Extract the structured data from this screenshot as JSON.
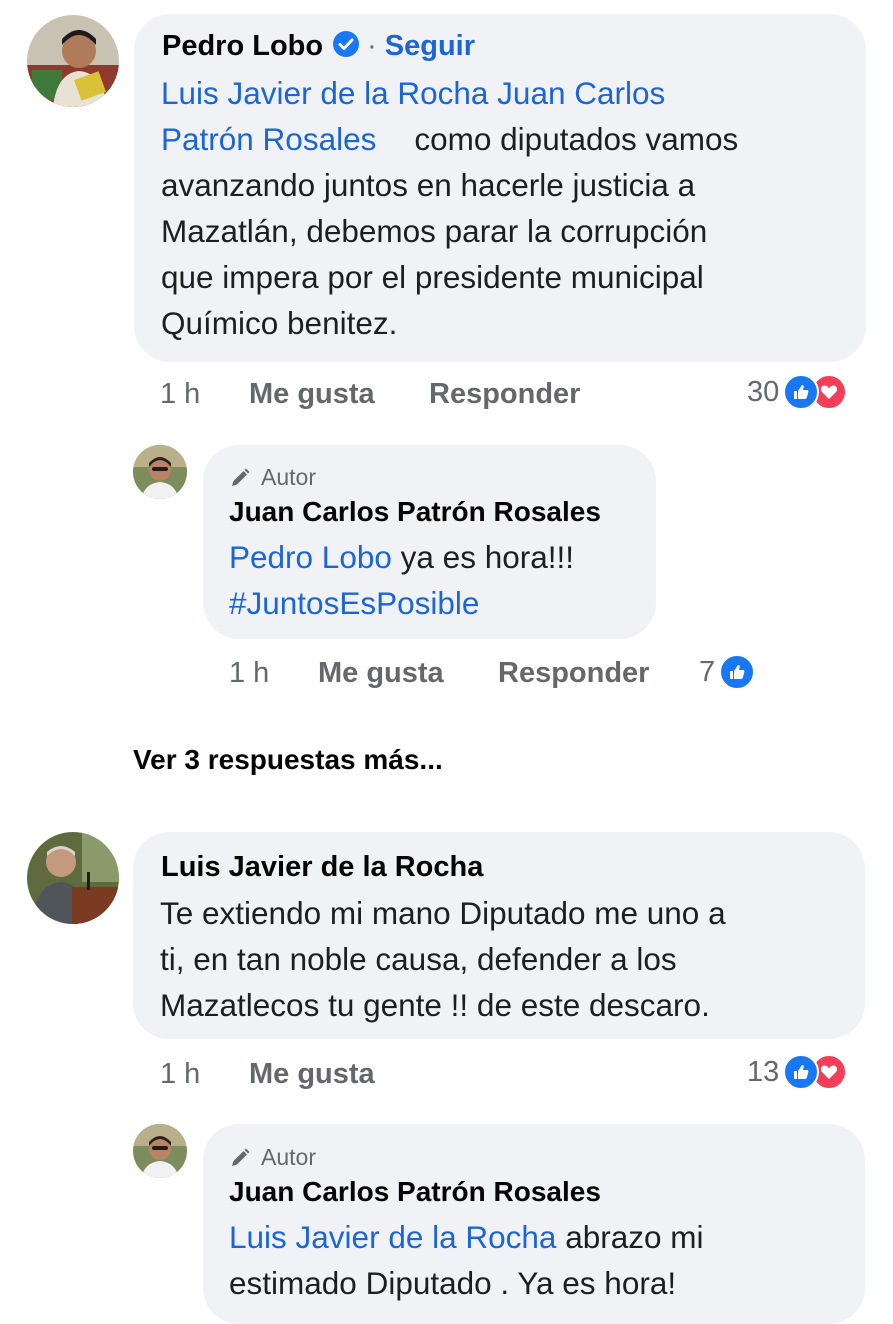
{
  "comments": [
    {
      "name": "Pedro Lobo",
      "separator": "·",
      "follow_label": "Seguir",
      "mention_line1": "Luis Javier de la Rocha Juan Carlos",
      "mention_line2": "Patrón Rosales",
      "text_line2": "como diputados vamos",
      "text_line3": "avanzando juntos en hacerle justicia a",
      "text_line4": "Mazatlán, debemos parar la corrupción",
      "text_line5": "que impera por el presidente municipal",
      "text_line6": "Químico benitez.",
      "time": "1 h",
      "like_label": "Me gusta",
      "reply_label": "Responder",
      "reaction_count": "30"
    },
    {
      "name": "Luis Javier de la Rocha",
      "text_line1": "Te extiendo mi mano Diputado me uno a",
      "text_line2": "ti, en tan noble causa, defender a los",
      "text_line3": "Mazatlecos tu gente !! de este descaro.",
      "time": "1 h",
      "like_label": "Me gusta",
      "reaction_count": "13"
    }
  ],
  "replies": [
    {
      "author_badge": "Autor",
      "name": "Juan Carlos Patrón Rosales",
      "mention": "Pedro Lobo",
      "text_line1": "ya es hora!!!",
      "hashtag": "#JuntosEsPosible",
      "time": "1 h",
      "like_label": "Me gusta",
      "reply_label": "Responder",
      "reaction_count": "7"
    },
    {
      "author_badge": "Autor",
      "name": "Juan Carlos Patrón Rosales",
      "mention": "Luis Javier de la Rocha",
      "text_line1": "abrazo mi",
      "text_line2": "estimado Diputado . Ya es hora!"
    }
  ],
  "more_replies_label": "Ver 3 respuestas más...",
  "colors": {
    "bubble": "#f0f2f5",
    "link": "#1b65d6",
    "like": "#1877f2",
    "love": "#f33e58",
    "muted": "#65676b"
  },
  "icons": [
    "verified-badge-icon",
    "pencil-icon",
    "like-reaction-icon",
    "love-reaction-icon"
  ]
}
